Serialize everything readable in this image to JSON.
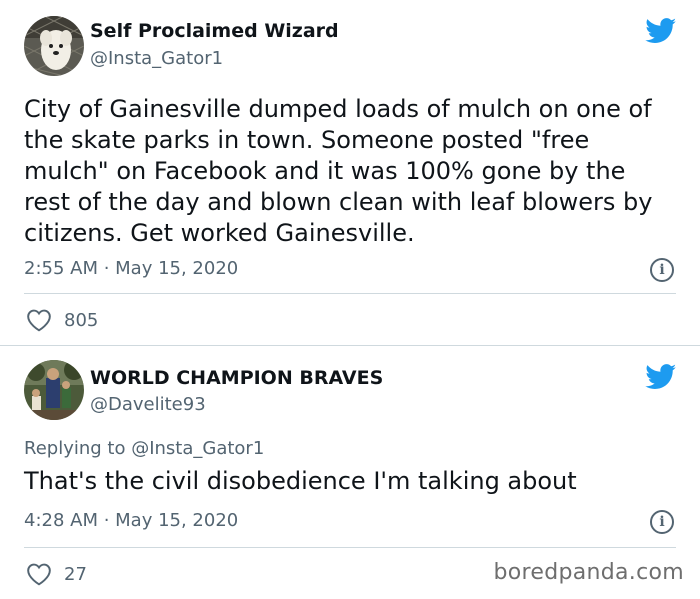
{
  "tweet1": {
    "display_name": "Self Proclaimed Wizard",
    "handle": "@Insta_Gator1",
    "text": "City of Gainesville dumped loads of mulch on one of the skate parks in town. Someone posted \"free mulch\" on Facebook and it was 100% gone by the rest of the day and blown clean with leaf blowers by citizens. Get worked Gainesville.",
    "timestamp": "2:55 AM · May 15, 2020",
    "likes": "805",
    "avatar_icon": "dog-avatar-icon",
    "brand_icon": "twitter-bird-icon"
  },
  "tweet2": {
    "display_name": "WORLD CHAMPION BRAVES",
    "handle": "@Davelite93",
    "reply_prefix": "Replying to @Insta_Gator1",
    "text": "That's the civil disobedience I'm talking about",
    "timestamp": "4:28 AM · May 15, 2020",
    "likes": "27",
    "avatar_icon": "family-photo-avatar-icon",
    "brand_icon": "twitter-bird-icon"
  },
  "watermark": "boredpanda.com",
  "colors": {
    "twitter_blue": "#1d9bf0",
    "secondary_text": "#536471",
    "divider": "#cfd9de"
  }
}
